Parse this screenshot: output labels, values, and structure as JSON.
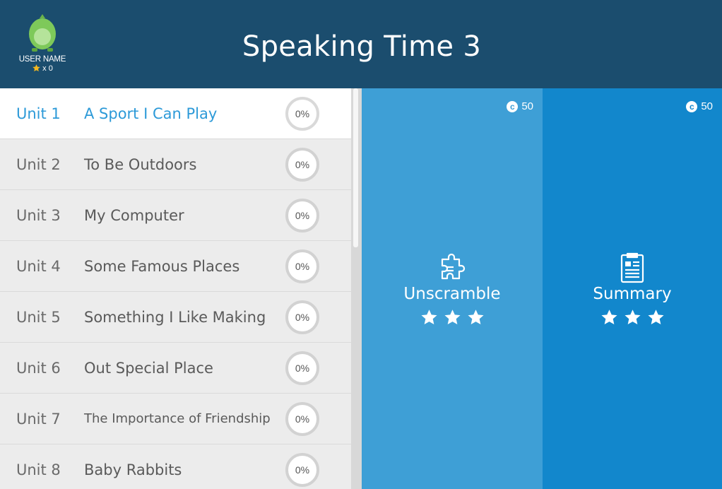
{
  "header": {
    "title": "Speaking Time 3",
    "user_name": "USER NAME",
    "star_count": "x 0",
    "mascot_icon": "dinosaur-egg-mascot-icon",
    "star_icon": "star-icon",
    "background": "#1b4d6e"
  },
  "units": [
    {
      "num": "Unit 1",
      "title": "A Sport I Can Play",
      "progress": "0%",
      "active": true
    },
    {
      "num": "Unit 2",
      "title": "To Be Outdoors",
      "progress": "0%",
      "active": false
    },
    {
      "num": "Unit 3",
      "title": "My Computer",
      "progress": "0%",
      "active": false
    },
    {
      "num": "Unit 4",
      "title": "Some Famous Places",
      "progress": "0%",
      "active": false
    },
    {
      "num": "Unit 5",
      "title": "Something I Like Making",
      "progress": "0%",
      "active": false
    },
    {
      "num": "Unit 6",
      "title": "Out Special Place",
      "progress": "0%",
      "active": false
    },
    {
      "num": "Unit 7",
      "title": "The Importance of Friendship",
      "progress": "0%",
      "active": false
    },
    {
      "num": "Unit 8",
      "title": "Baby Rabbits",
      "progress": "0%",
      "active": false
    }
  ],
  "activities": [
    {
      "label": "Unscramble",
      "coins": "50",
      "icon": "puzzle-piece-icon",
      "stars": 3,
      "color": "#3e9fd6"
    },
    {
      "label": "Summary",
      "coins": "50",
      "icon": "clipboard-document-icon",
      "stars": 3,
      "color": "#1287cc"
    }
  ],
  "colors": {
    "active_text": "#2d9ad8",
    "list_bg": "#ececec"
  }
}
